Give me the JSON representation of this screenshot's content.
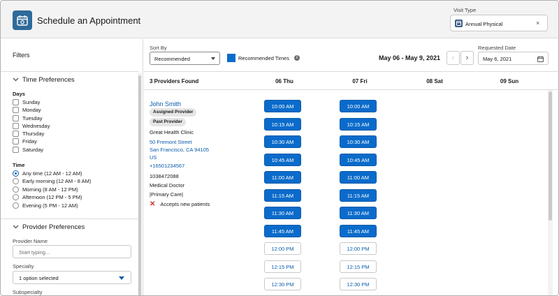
{
  "header": {
    "title": "Schedule an Appointment",
    "visit_type_label": "Visit Type",
    "visit_type_value": "Annual Physical",
    "remove_glyph": "×"
  },
  "sidebar": {
    "title": "Filters",
    "time_prefs": {
      "title": "Time Preferences",
      "days_label": "Days",
      "days": [
        "Sunday",
        "Monday",
        "Tuesday",
        "Wednesday",
        "Thursday",
        "Friday",
        "Saturday"
      ],
      "time_label": "Time",
      "times": [
        {
          "label": "Any time (12 AM - 12 AM)",
          "selected": true
        },
        {
          "label": "Early morning (12 AM - 8 AM)",
          "selected": false
        },
        {
          "label": "Morning (8 AM - 12 PM)",
          "selected": false
        },
        {
          "label": "Afternoon (12 PM - 5 PM)",
          "selected": false
        },
        {
          "label": "Evening (5 PM - 12 AM)",
          "selected": false
        }
      ]
    },
    "provider_prefs": {
      "title": "Provider Preferences",
      "provider_name_label": "Provider Name",
      "provider_name_placeholder": "Start typing...",
      "specialty_label": "Specialty",
      "specialty_value": "1 option selected",
      "subspecialty_label": "Subspecialty"
    }
  },
  "toolbar": {
    "sort_by_label": "Sort By",
    "sort_by_value": "Recommended",
    "recommended_times_label": "Recommended Times",
    "date_range": "May 06 - May 9, 2021",
    "requested_date_label": "Requested Date",
    "requested_date_value": "May 6, 2021",
    "prev_glyph": "‹",
    "next_glyph": "›",
    "recommended_color": "#0b6bcb"
  },
  "grid": {
    "providers_found": "3 Providers Found",
    "days": [
      "06 Thu",
      "07 Fri",
      "08 Sat",
      "09 Sun"
    ]
  },
  "provider": {
    "name": "John Smith",
    "badges": [
      "Assigned Provider",
      "Past Provider"
    ],
    "clinic": "Great Health Clinic",
    "address_line1": "50 Fremont Street",
    "address_line2": "San Francisco, CA 94105",
    "country": "US",
    "phone": "+16501234567",
    "id": "1038472088",
    "title": "Medical Doctor",
    "specialty": "|Primary Care|",
    "accepts_new": "Accepts new patients"
  },
  "slots": {
    "thu": [
      {
        "time": "10:00 AM",
        "recommended": true
      },
      {
        "time": "10:15 AM",
        "recommended": true
      },
      {
        "time": "10:30 AM",
        "recommended": true
      },
      {
        "time": "10:45 AM",
        "recommended": true
      },
      {
        "time": "11:00 AM",
        "recommended": true
      },
      {
        "time": "11:15 AM",
        "recommended": true
      },
      {
        "time": "11:30 AM",
        "recommended": true
      },
      {
        "time": "11:45 AM",
        "recommended": true
      },
      {
        "time": "12:00 PM",
        "recommended": false
      },
      {
        "time": "12:15 PM",
        "recommended": false
      },
      {
        "time": "12:30 PM",
        "recommended": false
      }
    ],
    "fri": [
      {
        "time": "10:00 AM",
        "recommended": true
      },
      {
        "time": "10:15 AM",
        "recommended": true
      },
      {
        "time": "10:30 AM",
        "recommended": true
      },
      {
        "time": "10:45 AM",
        "recommended": true
      },
      {
        "time": "11:00 AM",
        "recommended": true
      },
      {
        "time": "11:15 AM",
        "recommended": true
      },
      {
        "time": "11:30 AM",
        "recommended": true
      },
      {
        "time": "11:45 AM",
        "recommended": true
      },
      {
        "time": "12:00 PM",
        "recommended": false
      },
      {
        "time": "12:15 PM",
        "recommended": false
      },
      {
        "time": "12:30 PM",
        "recommended": false
      }
    ]
  }
}
